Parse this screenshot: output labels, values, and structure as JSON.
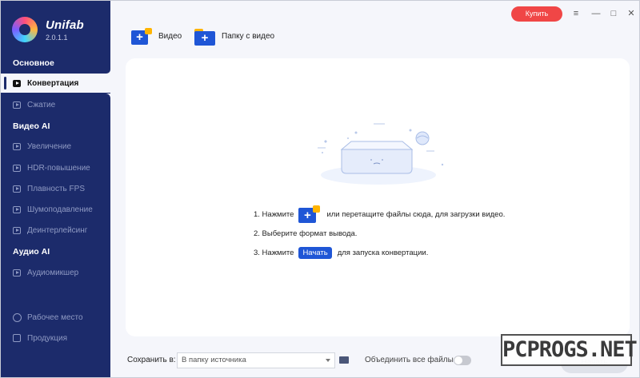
{
  "app": {
    "name": "Unifab",
    "version": "2.0.1.1"
  },
  "titlebar": {
    "buy_label": "Купить",
    "menu_glyph": "≡",
    "minimize_glyph": "—",
    "maximize_glyph": "□",
    "close_glyph": "✕"
  },
  "sidebar": {
    "sections": [
      {
        "title": "Основное",
        "items": [
          {
            "label": "Конвертация",
            "active": true
          },
          {
            "label": "Сжатие"
          }
        ]
      },
      {
        "title": "Видео AI",
        "items": [
          {
            "label": "Увеличение"
          },
          {
            "label": "HDR-повышение"
          },
          {
            "label": "Плавность FPS"
          },
          {
            "label": "Шумоподавление"
          },
          {
            "label": "Деинтерлейсинг"
          }
        ]
      },
      {
        "title": "Аудио AI",
        "items": [
          {
            "label": "Аудиомикшер"
          }
        ]
      }
    ],
    "footer": [
      {
        "label": "Рабочее место"
      },
      {
        "label": "Продукция"
      }
    ]
  },
  "toolbar": {
    "add_video_label": "Видео",
    "add_folder_label": "Папку с видео"
  },
  "main": {
    "step1_prefix": "1. Нажмите",
    "step1_suffix": "или перетащите файлы сюда, для загрузки видео.",
    "step2": "2. Выберите формат вывода.",
    "step3_prefix": "3. Нажмите",
    "step3_pill": "Начать",
    "step3_suffix": "для запуска конвертации."
  },
  "bottom": {
    "save_label": "Сохранить в:",
    "save_path": "В папку источника",
    "merge_label": "Объединить все файлы",
    "merge_enabled": false,
    "start_label": "Начать"
  },
  "watermark": "PCPROGS.NET",
  "colors": {
    "sidebar": "#1c2b6b",
    "accent": "#1f56d6",
    "buy": "#f04646",
    "folder_tab": "#ffb400"
  }
}
